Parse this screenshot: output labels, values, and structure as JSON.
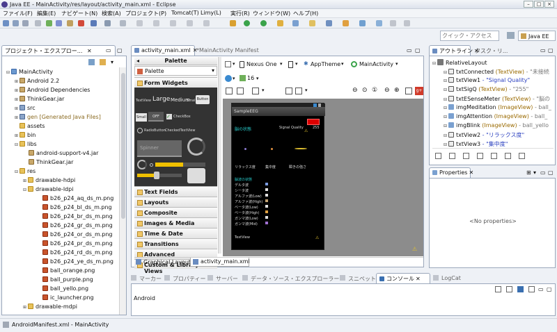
{
  "window": {
    "title": "Java EE - MainActivity/res/layout/activity_main.xml - Eclipse"
  },
  "menu": [
    "ファイル(F)",
    "編集(E)",
    "ナビゲート(N)",
    "検索(A)",
    "プロジェクト(P)",
    "Tomcat(T)",
    "Limy(L)",
    "実行(R)",
    "ウィンドウ(W)",
    "ヘルプ(H)"
  ],
  "quick_access": {
    "placeholder": "クイック・アクセス"
  },
  "perspective": "Java EE",
  "project_explorer": {
    "title": "プロジェクト・エクスプロー...",
    "items": [
      "MainActivity",
      "Android 2.2",
      "Android Dependencies",
      "ThinkGear.jar",
      "src",
      "gen [Generated Java Files]",
      "assets",
      "bin",
      "libs",
      "android-support-v4.jar",
      "ThinkGear.jar",
      "res",
      "drawable-hdpi",
      "drawable-ldpi",
      "b26_p24_aq_ds_m.png",
      "b26_p24_bl_ds_m.png",
      "b26_p24_br_ds_m.png",
      "b26_p24_gr_ds_m.png",
      "b26_p24_or_ds_m.png",
      "b26_p24_pr_ds_m.png",
      "b26_p24_rd_ds_m.png",
      "b26_p24_ye_ds_m.png",
      "ball_orange.png",
      "ball_purple.png",
      "ball_yello.png",
      "ic_launcher.png",
      "drawable-mdpi"
    ]
  },
  "editor": {
    "tabs": [
      "activity_main.xml",
      "*MainActivity Manifest"
    ],
    "palette_label": "Palette",
    "palette_dropdown": "Palette",
    "sections": [
      "Form Widgets",
      "Text Fields",
      "Layouts",
      "Composite",
      "Images & Media",
      "Time & Date",
      "Transitions",
      "Advanced",
      "Custom & Library Views"
    ],
    "widgets": {
      "textview": "TextView",
      "large": "Large",
      "medium": "Medium",
      "small": "Small",
      "button": "Button",
      "small_btn": "Small",
      "off": "OFF",
      "checkbox": "CheckBox",
      "radio": "RadioButton",
      "checked_tv": "CheckedTextView",
      "spinner": "Spinner"
    },
    "device": "Nexus One",
    "theme": "AppTheme",
    "activity": "MainActivity",
    "api": "16",
    "bottom_tabs": [
      "Graphical Layout",
      "activity_main.xml"
    ]
  },
  "phone": {
    "app_title": "SampleEEG",
    "brain_label": "脳の状態",
    "signal_quality": "Signal Quality",
    "signal_value": "255",
    "red_badge": "",
    "labels": [
      "リラックス度",
      "集中度",
      "瞬きの強さ"
    ],
    "wave_title": "脳波の状態",
    "waves": [
      "デルタ波",
      "シータ波",
      "アルファ波(Low)",
      "アルファ波(High)",
      "ベータ波(Low)",
      "ベータ波(High)",
      "ガンマ波(Low)",
      "ガンマ波(Mid)"
    ],
    "footer": "TextView"
  },
  "outline": {
    "title": "アウトライン",
    "other_tab": "タスク・リ...",
    "root": "RelativeLayout",
    "items": [
      {
        "name": "txtConnected",
        "type": "(TextView)",
        "value": "- \"未接続"
      },
      {
        "name": "txtView1",
        "type": "",
        "value": "- \"Signal Quality\""
      },
      {
        "name": "txtSigQ",
        "type": "(TextView)",
        "value": "- \"255\""
      },
      {
        "name": "txtESenseMeter",
        "type": "(TextView)",
        "value": "- \"脳の"
      },
      {
        "name": "imgMeditation",
        "type": "(ImageView)",
        "value": "- ball_"
      },
      {
        "name": "imgAttention",
        "type": "(ImageView)",
        "value": "- ball_"
      },
      {
        "name": "imgBlink",
        "type": "(ImageView)",
        "value": "- ball_yello"
      },
      {
        "name": "txtView2",
        "type": "",
        "value": "- \"リラックス度\""
      },
      {
        "name": "txtView3",
        "type": "",
        "value": "- \"集中度\""
      }
    ]
  },
  "properties": {
    "title": "Properties",
    "empty": "<No properties>"
  },
  "bottom_tabs": [
    "マーカー",
    "プロパティー",
    "サーバー",
    "データ・ソース・エクスプローラー",
    "スニペット",
    "コンソール",
    "LogCat"
  ],
  "console": {
    "text": "Android"
  },
  "status": {
    "text": "AndroidManifest.xml - MainActivity"
  },
  "colors": {
    "accent": "#3a6fb0",
    "phone_bg": "#000000",
    "teal": "#27c6c6"
  }
}
